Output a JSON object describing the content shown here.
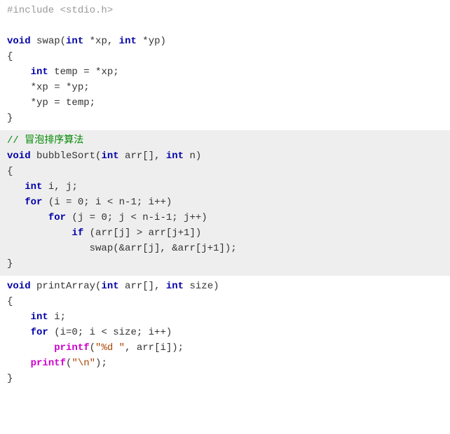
{
  "code": {
    "include_line": "#include <stdio.h>",
    "swap_sig_void": "void",
    "swap_sig_name": " swap(",
    "swap_sig_int1": "int",
    "swap_sig_p1": " *xp, ",
    "swap_sig_int2": "int",
    "swap_sig_p2": " *yp)",
    "swap_open": "{",
    "swap_l1a": "    ",
    "swap_l1_int": "int",
    "swap_l1b": " temp = *xp;",
    "swap_l2": "    *xp = *yp;",
    "swap_l3": "    *yp = temp;",
    "swap_close": "}",
    "bs_comment": "// 冒泡排序算法",
    "bs_sig_void": "void",
    "bs_sig_name": " bubbleSort(",
    "bs_sig_int1": "int",
    "bs_sig_p1": " arr[], ",
    "bs_sig_int2": "int",
    "bs_sig_p2": " n)",
    "bs_open": "{",
    "bs_l1a": "   ",
    "bs_l1_int": "int",
    "bs_l1b": " i, j;",
    "bs_for1a": "   ",
    "bs_for1_kw": "for",
    "bs_for1b": " (i = 0; i < n-1; i++)",
    "bs_for2a": "       ",
    "bs_for2_kw": "for",
    "bs_for2b": " (j = 0; j < n-i-1; j++)",
    "bs_if_a": "           ",
    "bs_if_kw": "if",
    "bs_if_b": " (arr[j] > arr[j+1])",
    "bs_swap": "              swap(&arr[j], &arr[j+1]);",
    "bs_close": "}",
    "pa_sig_void": "void",
    "pa_sig_name": " printArray(",
    "pa_sig_int1": "int",
    "pa_sig_p1": " arr[], ",
    "pa_sig_int2": "int",
    "pa_sig_p2": " size)",
    "pa_open": "{",
    "pa_l1a": "    ",
    "pa_l1_int": "int",
    "pa_l1b": " i;",
    "pa_for_a": "    ",
    "pa_for_kw": "for",
    "pa_for_b": " (i=0; i < size; i++)",
    "pa_printf1_a": "        ",
    "pa_printf1_fn": "printf",
    "pa_printf1_b": "(",
    "pa_printf1_str": "\"%d \"",
    "pa_printf1_c": ", arr[i]);",
    "pa_printf2_a": "    ",
    "pa_printf2_fn": "printf",
    "pa_printf2_b": "(",
    "pa_printf2_str": "\"\\n\"",
    "pa_printf2_c": ");",
    "pa_close": "}"
  }
}
